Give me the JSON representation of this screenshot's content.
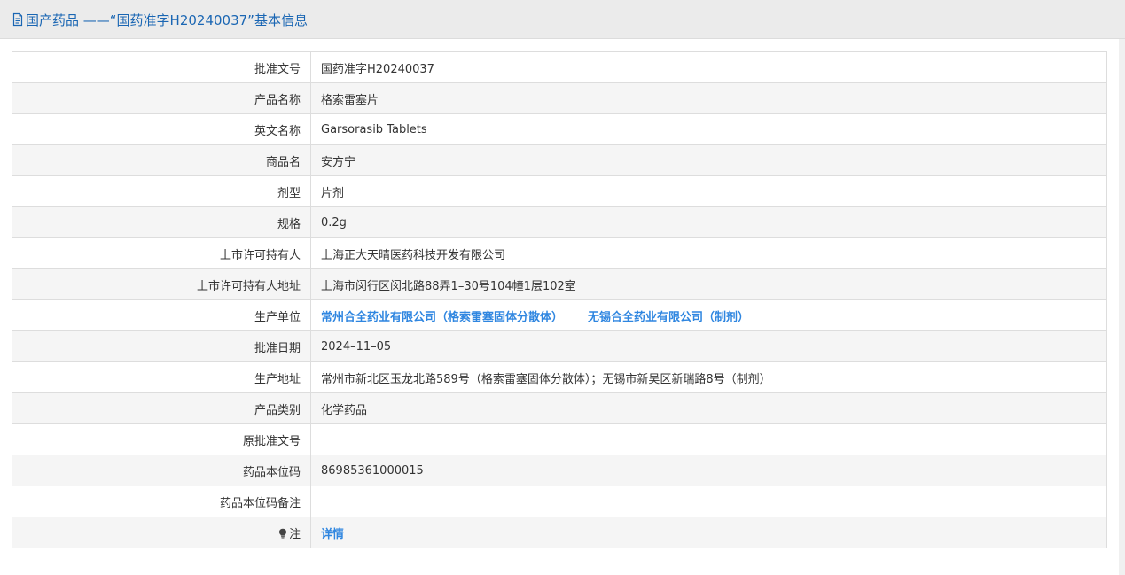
{
  "header": {
    "title": "国产药品 ——“国药准字H20240037”基本信息",
    "icon": "document-icon",
    "color": "#1a66b3"
  },
  "fields": {
    "approval_no": {
      "label": "批准文号",
      "value": "国药准字H20240037"
    },
    "product_name": {
      "label": "产品名称",
      "value": "格索雷塞片"
    },
    "english_name": {
      "label": "英文名称",
      "value": "Garsorasib Tablets"
    },
    "trade_name": {
      "label": "商品名",
      "value": "安方宁"
    },
    "dosage_form": {
      "label": "剂型",
      "value": "片剂"
    },
    "specification": {
      "label": "规格",
      "value": "0.2g"
    },
    "license_holder": {
      "label": "上市许可持有人",
      "value": "上海正大天晴医药科技开发有限公司"
    },
    "license_holder_address": {
      "label": "上市许可持有人地址",
      "value": "上海市闵行区闵北路88弄1–30号104幢1层102室"
    },
    "manufacturer": {
      "label": "生产单位",
      "links": [
        "常州合全药业有限公司（格索雷塞固体分散体）",
        "无锡合全药业有限公司（制剂）"
      ]
    },
    "approval_date": {
      "label": "批准日期",
      "value": "2024–11–05"
    },
    "production_address": {
      "label": "生产地址",
      "value": "常州市新北区玉龙北路589号（格索雷塞固体分散体）；无锡市新吴区新瑞路8号（制剂）"
    },
    "product_category": {
      "label": "产品类别",
      "value": "化学药品"
    },
    "original_approval_no": {
      "label": "原批准文号",
      "value": ""
    },
    "drug_code": {
      "label": "药品本位码",
      "value": "86985361000015"
    },
    "drug_code_note": {
      "label": "药品本位码备注",
      "value": ""
    },
    "note": {
      "label": "注",
      "link": "详情",
      "icon": "lightbulb-icon"
    }
  },
  "colors": {
    "link": "#2f86e0",
    "row_alt": "#f5f5f5",
    "border": "#dddddd",
    "header_bg": "#ebebeb"
  }
}
